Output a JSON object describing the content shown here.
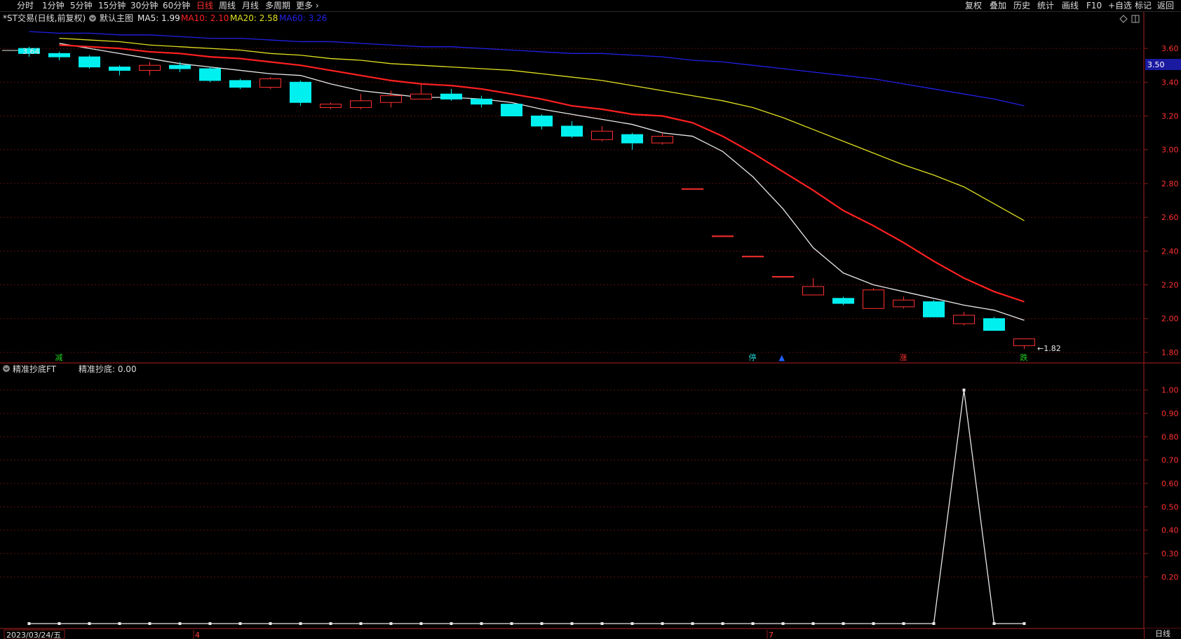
{
  "toolbar": {
    "left": [
      {
        "label": "分时",
        "active": false
      },
      {
        "label": "1分钟",
        "active": false
      },
      {
        "label": "5分钟",
        "active": false
      },
      {
        "label": "15分钟",
        "active": false
      },
      {
        "label": "30分钟",
        "active": false
      },
      {
        "label": "60分钟",
        "active": false
      },
      {
        "label": "日线",
        "active": true
      },
      {
        "label": "周线",
        "active": false
      },
      {
        "label": "月线",
        "active": false
      },
      {
        "label": "多周期",
        "active": false
      },
      {
        "label": "更多 ›",
        "active": false
      }
    ],
    "right": [
      {
        "label": "复权"
      },
      {
        "label": "叠加"
      },
      {
        "label": "历史"
      },
      {
        "label": "统计"
      },
      {
        "label": "画线"
      },
      {
        "label": "F10"
      },
      {
        "label": "+自选"
      },
      {
        "label": "标记"
      },
      {
        "label": "返回"
      }
    ]
  },
  "main_pane": {
    "title": "*ST交易(日线,前复权)",
    "indicator": "默认主图",
    "ma": [
      {
        "label": "MA5: 1.99",
        "color": "#e8e8e8"
      },
      {
        "label": "MA10: 2.10",
        "color": "#ff2020"
      },
      {
        "label": "MA20: 2.58",
        "color": "#e0e020"
      },
      {
        "label": "MA60: 3.26",
        "color": "#2020e8"
      }
    ],
    "high_mark": "3.64",
    "low_mark": "←1.82",
    "current_price": "3.50",
    "signals": [
      {
        "text": "减",
        "color": "#20d020"
      },
      {
        "text": "停",
        "color": "#20d0d0"
      },
      {
        "text": "▲",
        "color": "#2060ff"
      },
      {
        "text": "涨",
        "color": "#ff3030"
      },
      {
        "text": "跌",
        "color": "#20d020"
      }
    ]
  },
  "sub_pane": {
    "title": "精准抄底FT",
    "value_label": "精准抄底: 0.00"
  },
  "date_axis": {
    "start": "2023/03/24/五",
    "marks": [
      "4",
      "7"
    ]
  },
  "bottom_tab": "日线",
  "chart_data": [
    {
      "type": "candlestick",
      "title": "*ST交易(日线,前复权)",
      "ylim": [
        1.75,
        3.7
      ],
      "yticks": [
        "3.60",
        "3.40",
        "3.20",
        "3.00",
        "2.80",
        "2.60",
        "2.40",
        "2.20",
        "2.00",
        "1.80"
      ],
      "candles": [
        {
          "o": 3.6,
          "h": 3.61,
          "l": 3.55,
          "c": 3.57
        },
        {
          "o": 3.57,
          "h": 3.58,
          "l": 3.53,
          "c": 3.55
        },
        {
          "o": 3.55,
          "h": 3.56,
          "l": 3.48,
          "c": 3.49
        },
        {
          "o": 3.49,
          "h": 3.5,
          "l": 3.44,
          "c": 3.47
        },
        {
          "o": 3.47,
          "h": 3.52,
          "l": 3.44,
          "c": 3.5
        },
        {
          "o": 3.5,
          "h": 3.52,
          "l": 3.46,
          "c": 3.48
        },
        {
          "o": 3.48,
          "h": 3.49,
          "l": 3.4,
          "c": 3.41
        },
        {
          "o": 3.41,
          "h": 3.42,
          "l": 3.36,
          "c": 3.37
        },
        {
          "o": 3.37,
          "h": 3.43,
          "l": 3.36,
          "c": 3.42
        },
        {
          "o": 3.4,
          "h": 3.41,
          "l": 3.26,
          "c": 3.28
        },
        {
          "o": 3.25,
          "h": 3.28,
          "l": 3.24,
          "c": 3.27
        },
        {
          "o": 3.25,
          "h": 3.33,
          "l": 3.24,
          "c": 3.29
        },
        {
          "o": 3.28,
          "h": 3.35,
          "l": 3.25,
          "c": 3.32
        },
        {
          "o": 3.3,
          "h": 3.39,
          "l": 3.3,
          "c": 3.33
        },
        {
          "o": 3.33,
          "h": 3.36,
          "l": 3.29,
          "c": 3.3
        },
        {
          "o": 3.3,
          "h": 3.32,
          "l": 3.25,
          "c": 3.27
        },
        {
          "o": 3.27,
          "h": 3.27,
          "l": 3.2,
          "c": 3.2
        },
        {
          "o": 3.2,
          "h": 3.21,
          "l": 3.12,
          "c": 3.14
        },
        {
          "o": 3.14,
          "h": 3.17,
          "l": 3.07,
          "c": 3.08
        },
        {
          "o": 3.06,
          "h": 3.14,
          "l": 3.05,
          "c": 3.11
        },
        {
          "o": 3.09,
          "h": 3.1,
          "l": 3.0,
          "c": 3.04
        },
        {
          "o": 3.04,
          "h": 3.1,
          "l": 3.03,
          "c": 3.08
        },
        {
          "o": 2.77,
          "h": 2.77,
          "l": 2.77,
          "c": 2.77
        },
        {
          "o": 2.49,
          "h": 2.49,
          "l": 2.49,
          "c": 2.49
        },
        {
          "o": 2.37,
          "h": 2.37,
          "l": 2.37,
          "c": 2.37
        },
        {
          "o": 2.25,
          "h": 2.25,
          "l": 2.25,
          "c": 2.25
        },
        {
          "o": 2.14,
          "h": 2.24,
          "l": 2.14,
          "c": 2.19
        },
        {
          "o": 2.12,
          "h": 2.13,
          "l": 2.08,
          "c": 2.09
        },
        {
          "o": 2.06,
          "h": 2.18,
          "l": 2.06,
          "c": 2.17
        },
        {
          "o": 2.07,
          "h": 2.13,
          "l": 2.06,
          "c": 2.11
        },
        {
          "o": 2.1,
          "h": 2.11,
          "l": 2.01,
          "c": 2.01
        },
        {
          "o": 1.97,
          "h": 2.04,
          "l": 1.96,
          "c": 2.02
        },
        {
          "o": 2.0,
          "h": 2.01,
          "l": 1.93,
          "c": 1.93
        },
        {
          "o": 1.84,
          "h": 1.88,
          "l": 1.82,
          "c": 1.88
        }
      ],
      "ma_lines": [
        {
          "name": "MA5",
          "color": "#e8e8e8",
          "values": [
            3.63,
            3.6,
            3.57,
            3.54,
            3.51,
            3.49,
            3.47,
            3.45,
            3.44,
            3.39,
            3.35,
            3.33,
            3.31,
            3.31,
            3.3,
            3.28,
            3.24,
            3.21,
            3.18,
            3.15,
            3.1,
            3.08,
            2.99,
            2.84,
            2.65,
            2.42,
            2.27,
            2.2,
            2.16,
            2.12,
            2.08,
            2.05,
            1.99
          ]
        },
        {
          "name": "MA10",
          "color": "#ff2020",
          "values": [
            3.62,
            3.61,
            3.6,
            3.58,
            3.57,
            3.55,
            3.54,
            3.52,
            3.5,
            3.47,
            3.44,
            3.41,
            3.39,
            3.38,
            3.36,
            3.33,
            3.3,
            3.26,
            3.24,
            3.21,
            3.2,
            3.16,
            3.08,
            2.98,
            2.87,
            2.76,
            2.64,
            2.55,
            2.45,
            2.34,
            2.24,
            2.16,
            2.1
          ]
        },
        {
          "name": "MA20",
          "color": "#e0e020",
          "values": [
            3.66,
            3.65,
            3.64,
            3.62,
            3.61,
            3.6,
            3.59,
            3.57,
            3.56,
            3.54,
            3.53,
            3.51,
            3.5,
            3.49,
            3.48,
            3.47,
            3.45,
            3.43,
            3.41,
            3.38,
            3.35,
            3.32,
            3.29,
            3.25,
            3.19,
            3.12,
            3.05,
            2.98,
            2.91,
            2.85,
            2.78,
            2.68,
            2.58
          ]
        },
        {
          "name": "MA60",
          "color": "#2020e8",
          "values": [
            3.7,
            3.69,
            3.69,
            3.68,
            3.68,
            3.67,
            3.66,
            3.66,
            3.65,
            3.64,
            3.64,
            3.63,
            3.62,
            3.61,
            3.61,
            3.6,
            3.59,
            3.58,
            3.57,
            3.57,
            3.56,
            3.55,
            3.53,
            3.52,
            3.5,
            3.48,
            3.46,
            3.44,
            3.42,
            3.39,
            3.36,
            3.33,
            3.3,
            3.26
          ]
        }
      ]
    },
    {
      "type": "line",
      "title": "精准抄底FT",
      "ylim": [
        0.0,
        1.05
      ],
      "yticks": [
        "1.00",
        "0.90",
        "0.80",
        "0.70",
        "0.60",
        "0.50",
        "0.40",
        "0.30",
        "0.20"
      ],
      "series": [
        {
          "name": "精准抄底",
          "color": "#e8e8e8",
          "values": [
            0,
            0,
            0,
            0,
            0,
            0,
            0,
            0,
            0,
            0,
            0,
            0,
            0,
            0,
            0,
            0,
            0,
            0,
            0,
            0,
            0,
            0,
            0,
            0,
            0,
            0,
            0,
            0,
            0,
            0,
            0,
            1,
            0,
            0
          ]
        }
      ]
    }
  ]
}
